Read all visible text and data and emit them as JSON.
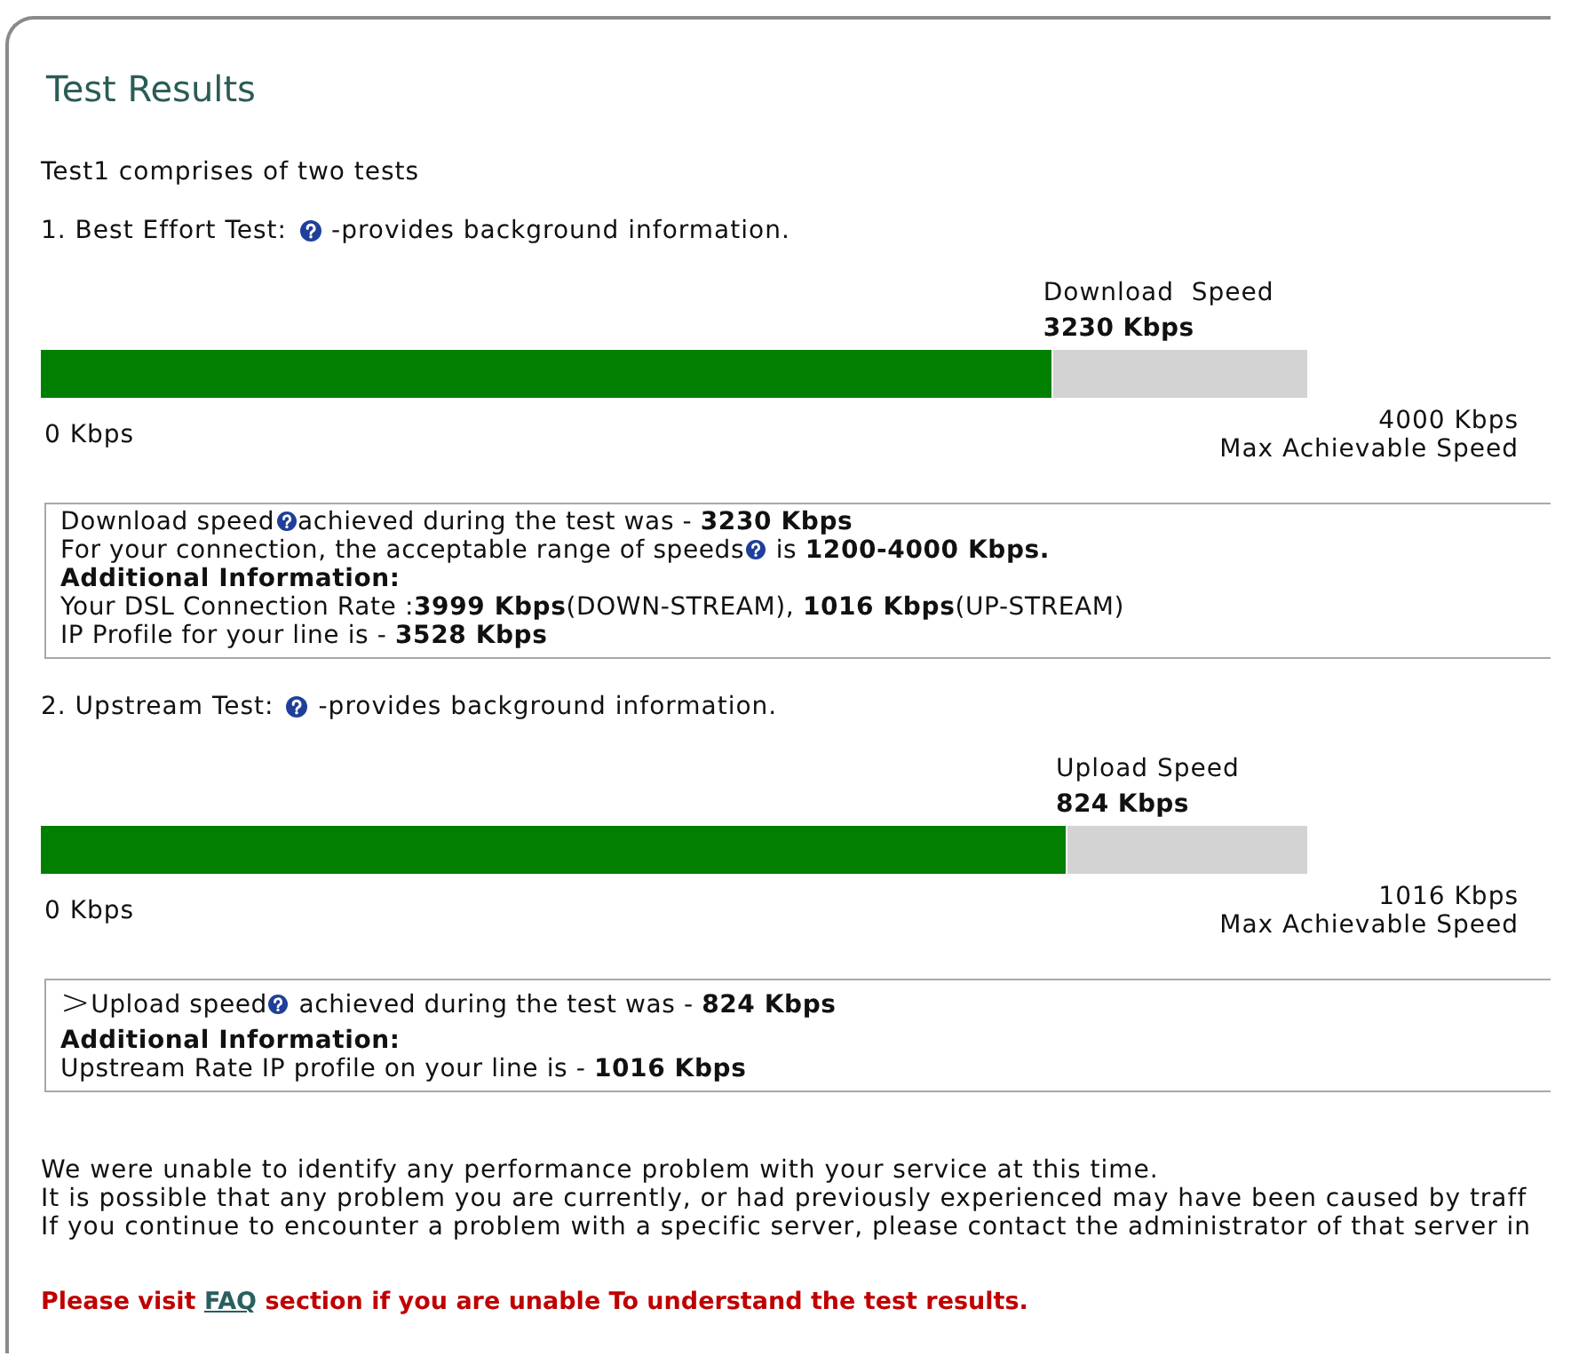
{
  "panel": {
    "title": "Test Results"
  },
  "intro": "Test1 comprises of two tests",
  "tests": [
    {
      "heading": "1. Best Effort Test:",
      "help_note": "-provides background information.",
      "meter": {
        "label": "Download  Speed",
        "reading": "3230 Kbps",
        "level": 0.8,
        "min_label": "0 Kbps",
        "max_reading": "4000 Kbps",
        "max_label": "Max Achievable Speed"
      },
      "details": [
        {
          "segments": [
            {
              "kind": "text",
              "text": "Download speed"
            },
            {
              "kind": "help"
            },
            {
              "kind": "text",
              "text": "achieved during the test was - **3230 Kbps**"
            }
          ]
        },
        {
          "segments": [
            {
              "kind": "text",
              "text": "For your connection, the acceptable range of speeds"
            },
            {
              "kind": "help"
            },
            {
              "kind": "text",
              "text": " is **1200-4000 Kbps.**"
            }
          ]
        },
        {
          "segments": [
            {
              "kind": "strong",
              "text": "Additional Information:"
            }
          ]
        },
        {
          "segments": [
            {
              "kind": "text",
              "text": "Your DSL Connection Rate :**3999 Kbps**(DOWN-STREAM), **1016 Kbps**(UP-STREAM)"
            }
          ]
        },
        {
          "segments": [
            {
              "kind": "text",
              "text": "IP Profile for your line is - **3528 Kbps**"
            }
          ]
        }
      ]
    },
    {
      "heading": "2. Upstream Test:",
      "help_note": "-provides background information.",
      "meter": {
        "label": "Upload Speed",
        "reading": "824 Kbps",
        "level": 0.81,
        "min_label": "0 Kbps",
        "max_reading": "1016 Kbps",
        "max_label": "Max Achievable Speed"
      },
      "details": [
        {
          "segments": [
            {
              "kind": "marker",
              "text": ">"
            },
            {
              "kind": "text",
              "text": "Upload speed"
            },
            {
              "kind": "help"
            },
            {
              "kind": "text",
              "text": " achieved during the test was - **824 Kbps**"
            }
          ]
        },
        {
          "segments": [
            {
              "kind": "strong",
              "text": "Additional Information:"
            }
          ]
        },
        {
          "segments": [
            {
              "kind": "text",
              "text": "Upstream Rate IP profile on your line is - **1016 Kbps**"
            }
          ]
        }
      ]
    }
  ],
  "messages": [
    "We were unable to identify any performance problem with your service at this time.",
    "It is possible that any problem you are currently, or had previously experienced may have been caused by traff",
    "If you continue to encounter a problem with a specific server, please contact the administrator of that server in"
  ],
  "notice": {
    "before": "Please visit",
    "link": "FAQ",
    "after": "section if you are unable To understand the test results."
  }
}
